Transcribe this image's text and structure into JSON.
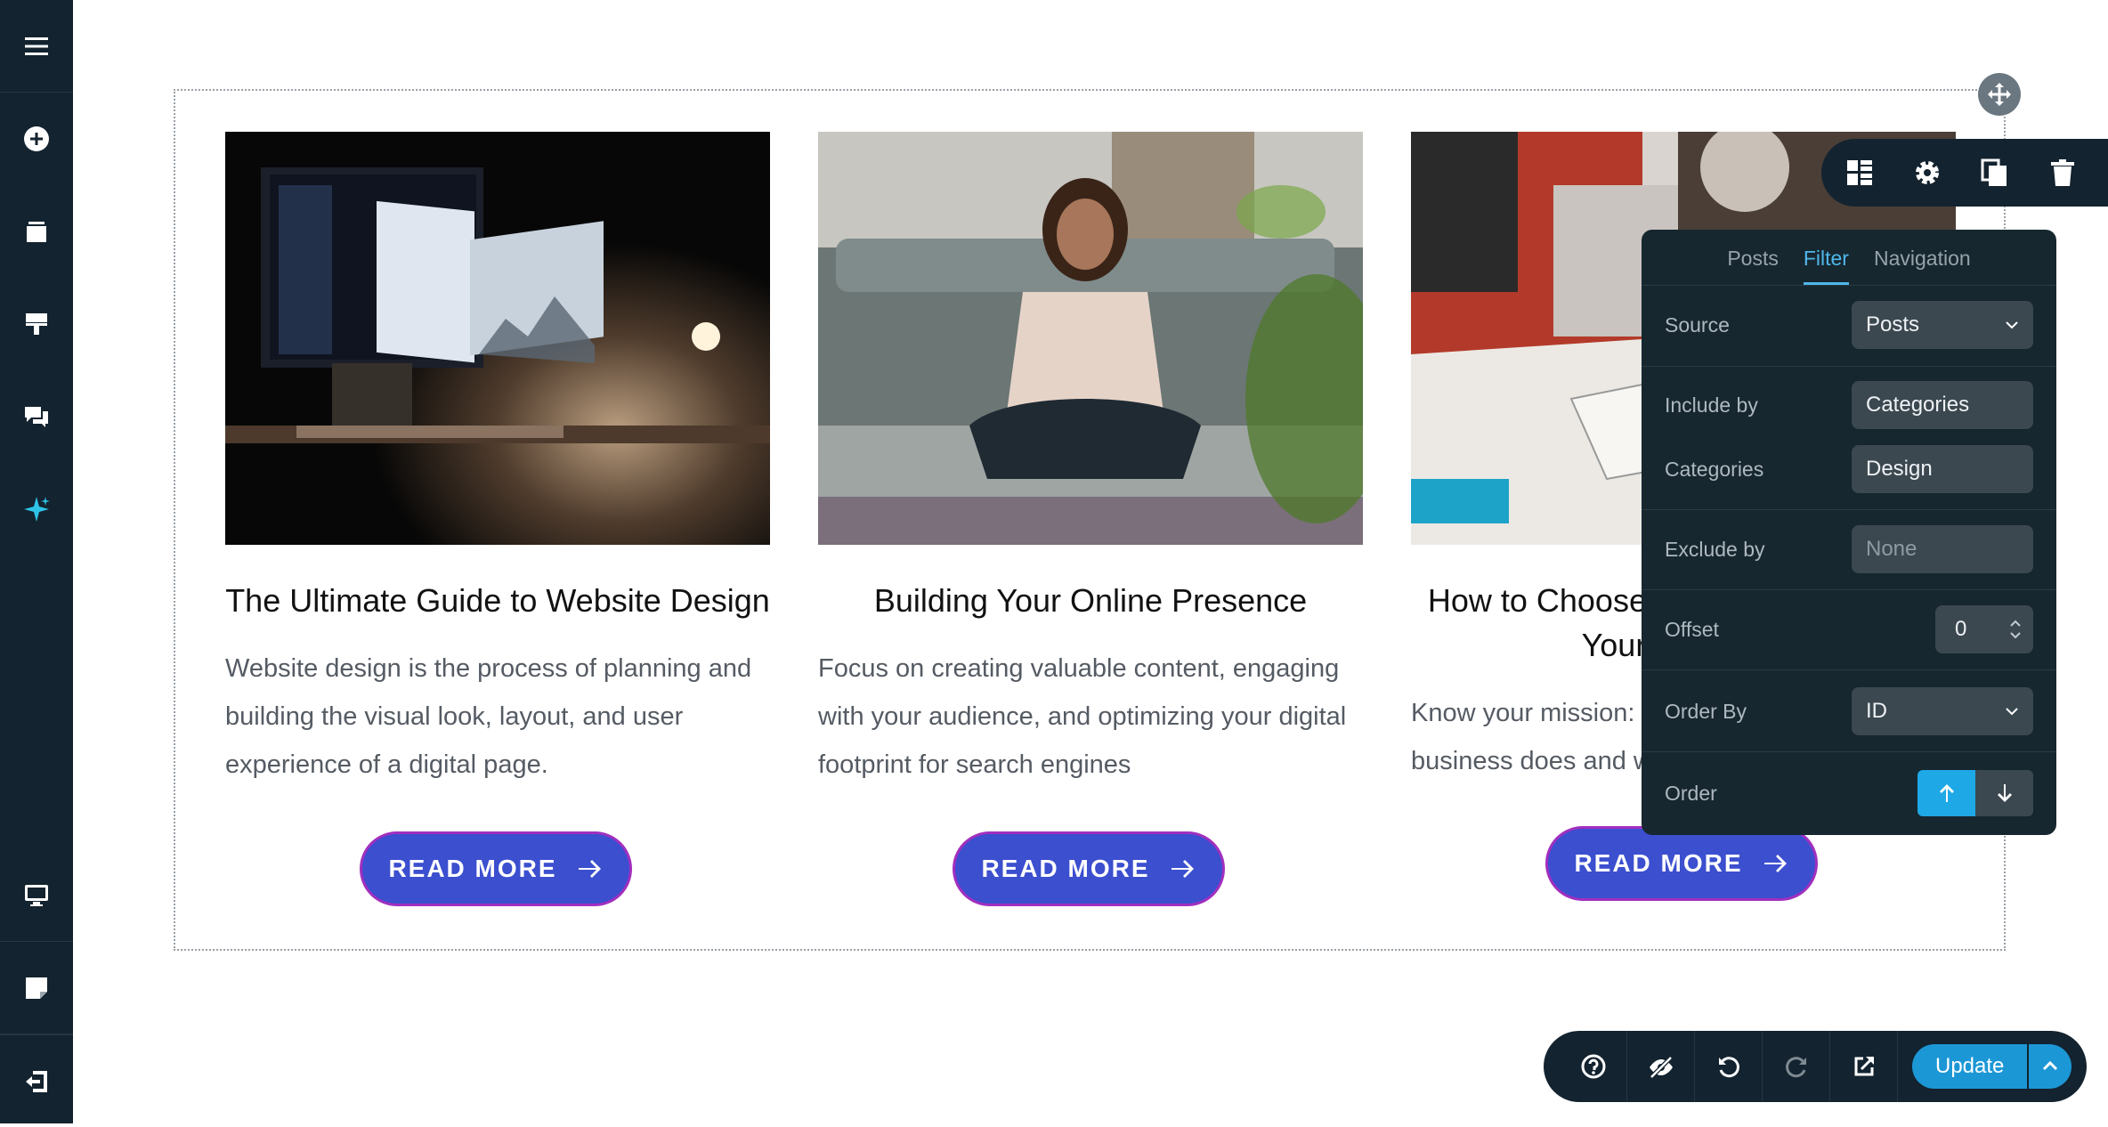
{
  "posts": [
    {
      "title": "The Ultimate Guide to Website Design",
      "excerpt": "Website design is the process of planning and building the visual look, layout, and user experience of a digital page.",
      "button": "READ MORE"
    },
    {
      "title": "Building Your Online Presence",
      "excerpt": "Focus on creating valuable content, engaging with your audience, and optimizing your digital footprint for search engines",
      "button": "READ MORE"
    },
    {
      "title": "How to Choose the Right Design for Your Business",
      "excerpt": "Know your mission: What is it what your business does and what values it stands for",
      "button": "READ MORE"
    }
  ],
  "panel": {
    "tabs": [
      "Posts",
      "Filter",
      "Navigation"
    ],
    "active_tab": "Filter",
    "source": {
      "label": "Source",
      "value": "Posts"
    },
    "include_by": {
      "label": "Include by",
      "value": "Categories"
    },
    "categories": {
      "label": "Categories",
      "value": "Design"
    },
    "exclude_by": {
      "label": "Exclude by",
      "value": "None"
    },
    "offset": {
      "label": "Offset",
      "value": "0"
    },
    "order_by": {
      "label": "Order By",
      "value": "ID"
    },
    "order": {
      "label": "Order",
      "selected": "ascending"
    }
  },
  "bottom_bar": {
    "update_label": "Update"
  },
  "colors": {
    "accent": "#1fa8e6",
    "sidebar": "#13232f",
    "button": "#3b4fcf",
    "button_border": "#a12fbf"
  }
}
